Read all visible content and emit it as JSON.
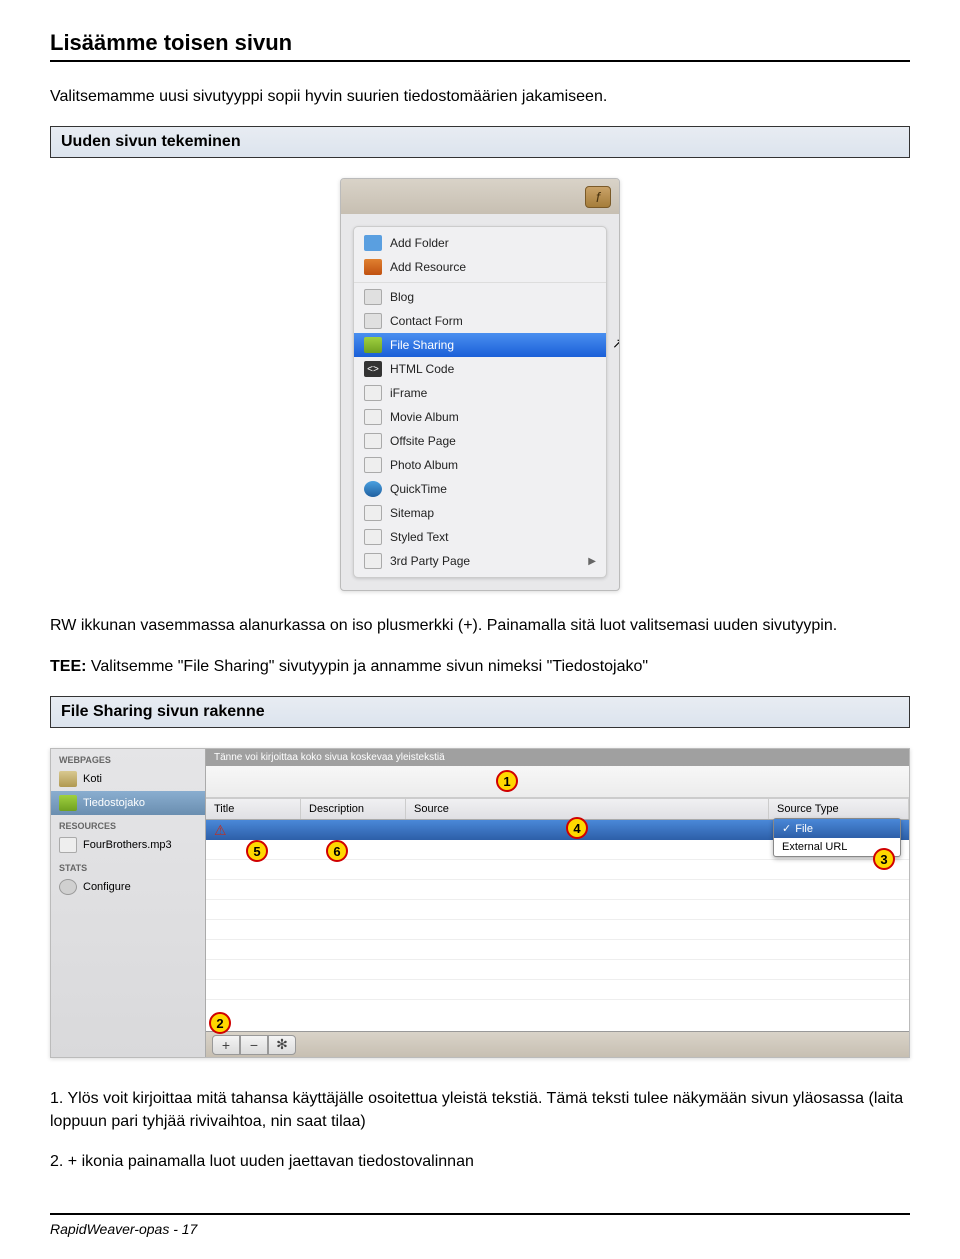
{
  "title": "Lisäämme toisen sivun",
  "intro": "Valitsemamme uusi sivutyyppi sopii hyvin suurien tiedostomäärien jakamiseen.",
  "section1": {
    "title": "Uuden sivun tekeminen"
  },
  "screenshot1": {
    "tool_button": "f",
    "menu_items": [
      {
        "icon": "ic-folder",
        "label": "Add Folder"
      },
      {
        "icon": "ic-resource",
        "label": "Add Resource"
      },
      {
        "icon": "ic-blog",
        "label": "Blog",
        "sep": true
      },
      {
        "icon": "ic-contact",
        "label": "Contact Form"
      },
      {
        "icon": "ic-fileshare",
        "label": "File Sharing",
        "selected": true
      },
      {
        "icon": "ic-html",
        "label": "HTML Code",
        "icon_text": "<>"
      },
      {
        "icon": "ic-iframe",
        "label": "iFrame"
      },
      {
        "icon": "ic-movie",
        "label": "Movie Album"
      },
      {
        "icon": "ic-offsite",
        "label": "Offsite Page"
      },
      {
        "icon": "ic-photo",
        "label": "Photo Album"
      },
      {
        "icon": "ic-quicktime",
        "label": "QuickTime"
      },
      {
        "icon": "ic-sitemap",
        "label": "Sitemap"
      },
      {
        "icon": "ic-styled",
        "label": "Styled Text"
      },
      {
        "icon": "ic-3rd",
        "label": "3rd Party Page",
        "arrow": true
      }
    ]
  },
  "para1": "RW ikkunan vasemmassa alanurkassa on iso plusmerkki (+). Painamalla sitä luot valitsemasi uuden sivutyypin.",
  "para2_label": "TEE:",
  "para2": " Valitsemme \"File Sharing\" sivutyypin ja annamme sivun nimeksi \"Tiedostojako\"",
  "section2": {
    "title": "File Sharing sivun rakenne"
  },
  "screenshot2": {
    "sidebar": {
      "webpages_header": "WEBPAGES",
      "items_webpages": [
        {
          "icon": "ic-home",
          "label": "Koti"
        },
        {
          "icon": "ic-fs",
          "label": "Tiedostojako",
          "selected": true
        }
      ],
      "resources_header": "RESOURCES",
      "items_resources": [
        {
          "icon": "ic-mp3",
          "label": "FourBrothers.mp3"
        }
      ],
      "stats_header": "STATS",
      "items_stats": [
        {
          "icon": "ic-cog",
          "label": "Configure"
        }
      ]
    },
    "intro_text": "Tänne voi kirjoittaa koko sivua koskevaa yleistekstiä",
    "columns": {
      "title": "Title",
      "description": "Description",
      "source": "Source",
      "source_type": "Source Type"
    },
    "warning_icon": "⚠",
    "dropdown": {
      "file": "File",
      "external": "External URL"
    },
    "bottom_buttons": [
      "+",
      "−",
      "✻"
    ],
    "markers": {
      "m1": "1",
      "m2": "2",
      "m3": "3",
      "m4": "4",
      "m5": "5",
      "m6": "6"
    }
  },
  "list": {
    "item1": "1. Ylös voit kirjoittaa mitä tahansa käyttäjälle osoitettua yleistä tekstiä. Tämä teksti tulee näkymään sivun yläosassa (laita loppuun pari tyhjää rivivaihtoa, nin saat tilaa)",
    "item2": "2. + ikonia painamalla luot uuden jaettavan tiedostovalinnan"
  },
  "footer": "RapidWeaver-opas - 17"
}
